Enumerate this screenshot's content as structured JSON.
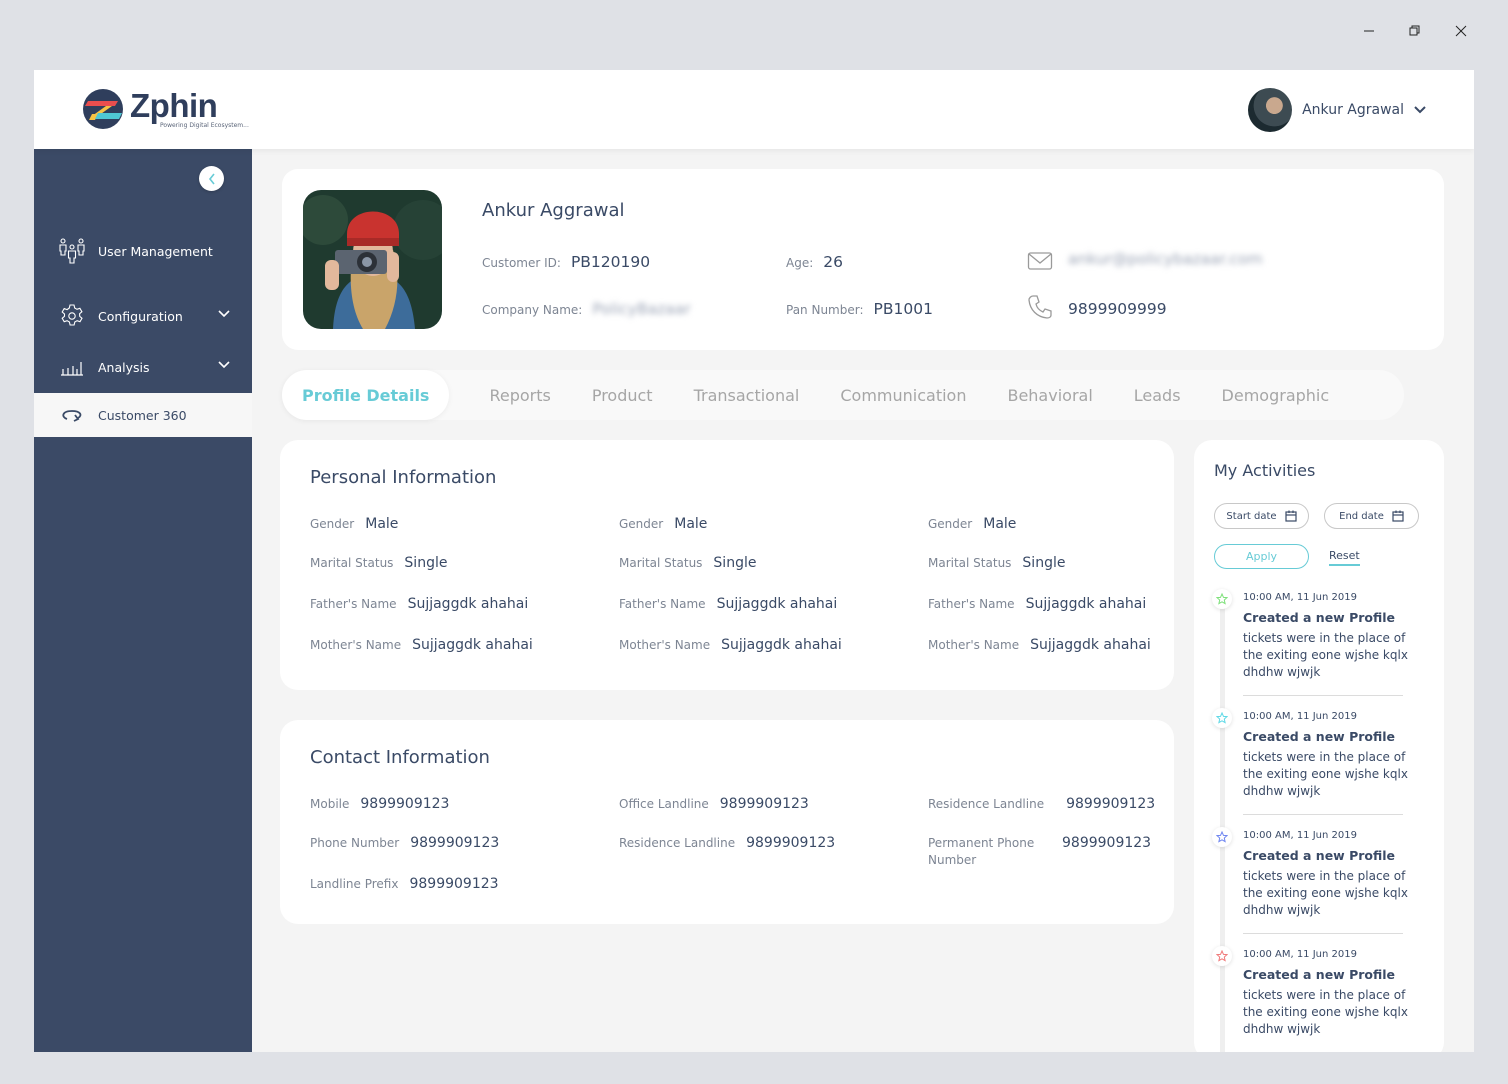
{
  "window": {
    "minimize_icon": "minimize-icon",
    "restore_icon": "restore-icon",
    "close_icon": "close-icon"
  },
  "header": {
    "logo_text": "Zphin",
    "logo_tagline": "Powering Digital Ecosystem...",
    "user_name": "Ankur Agrawal"
  },
  "sidebar": {
    "items": [
      {
        "label": "User Management",
        "icon": "users-icon",
        "has_chevron": false
      },
      {
        "label": "Configuration",
        "icon": "gear-icon",
        "has_chevron": true
      },
      {
        "label": "Analysis",
        "icon": "bar-chart-icon",
        "has_chevron": true
      },
      {
        "label": "Customer 360",
        "icon": "rotate-360-icon",
        "has_chevron": false,
        "active": true
      }
    ]
  },
  "profile": {
    "name": "Ankur Aggrawal",
    "customer_id_label": "Customer ID:",
    "customer_id": "PB120190",
    "age_label": "Age:",
    "age": "26",
    "company_label": "Company Name:",
    "company": "PolicyBazaar",
    "pan_label": "Pan Number:",
    "pan": "PB1001",
    "email": "ankur@policybazaar.com",
    "phone": "9899909999"
  },
  "tabs": [
    {
      "label": "Profile Details",
      "active": true
    },
    {
      "label": "Reports"
    },
    {
      "label": "Product"
    },
    {
      "label": "Transactional"
    },
    {
      "label": "Communication"
    },
    {
      "label": "Behavioral"
    },
    {
      "label": "Leads"
    },
    {
      "label": "Demographic"
    }
  ],
  "personal": {
    "title": "Personal Information",
    "columns": [
      [
        {
          "label": "Gender",
          "value": "Male"
        },
        {
          "label": "Marital Status",
          "value": "Single"
        },
        {
          "label": "Father's Name",
          "value": "Sujjaggdk ahahai"
        },
        {
          "label": "Mother's Name",
          "value": "Sujjaggdk ahahai"
        }
      ],
      [
        {
          "label": "Gender",
          "value": "Male"
        },
        {
          "label": "Marital Status",
          "value": "Single"
        },
        {
          "label": "Father's Name",
          "value": "Sujjaggdk ahahai"
        },
        {
          "label": "Mother's Name",
          "value": "Sujjaggdk ahahai"
        }
      ],
      [
        {
          "label": "Gender",
          "value": "Male"
        },
        {
          "label": "Marital Status",
          "value": "Single"
        },
        {
          "label": "Father's Name",
          "value": "Sujjaggdk ahahai"
        },
        {
          "label": "Mother's Name",
          "value": "Sujjaggdk ahahai"
        }
      ]
    ]
  },
  "contact": {
    "title": "Contact Information",
    "columns": [
      [
        {
          "label": "Mobile",
          "value": "9899909123"
        },
        {
          "label": "Phone Number",
          "value": "9899909123"
        },
        {
          "label": "Landline Prefix",
          "value": "9899909123"
        }
      ],
      [
        {
          "label": "Office Landline",
          "value": "9899909123"
        },
        {
          "label": "Residence Landline",
          "value": "9899909123"
        }
      ],
      [
        {
          "label": "Residence Landline",
          "value": "9899909123"
        },
        {
          "label": "Permanent Phone Number",
          "value": "9899909123"
        }
      ]
    ]
  },
  "activities": {
    "title": "My Activities",
    "start_date": "Start date",
    "end_date": "End date",
    "apply": "Apply",
    "reset": "Reset",
    "items": [
      {
        "time": "10:00 AM, 11 Jun 2019",
        "title": "Created a new Profile",
        "desc": "tickets were in the place of the exiting eone wjshe kqlx dhdhw wjwjk",
        "color": "#7ee07a"
      },
      {
        "time": "10:00 AM, 11 Jun 2019",
        "title": "Created a new Profile",
        "desc": "tickets were in the place of the exiting eone wjshe kqlx dhdhw wjwjk",
        "color": "#5fd9e6"
      },
      {
        "time": "10:00 AM, 11 Jun 2019",
        "title": "Created a new Profile",
        "desc": "tickets were in the place of the exiting eone wjshe kqlx dhdhw wjwjk",
        "color": "#6f86f0"
      },
      {
        "time": "10:00 AM, 11 Jun 2019",
        "title": "Created a new Profile",
        "desc": "tickets were in the place of the exiting eone wjshe kqlx dhdhw wjwjk",
        "color": "#f07a7a"
      }
    ]
  },
  "colors": {
    "accent": "#67cbd6",
    "sidebar": "#3b4a66",
    "text": "#3a4a66"
  }
}
